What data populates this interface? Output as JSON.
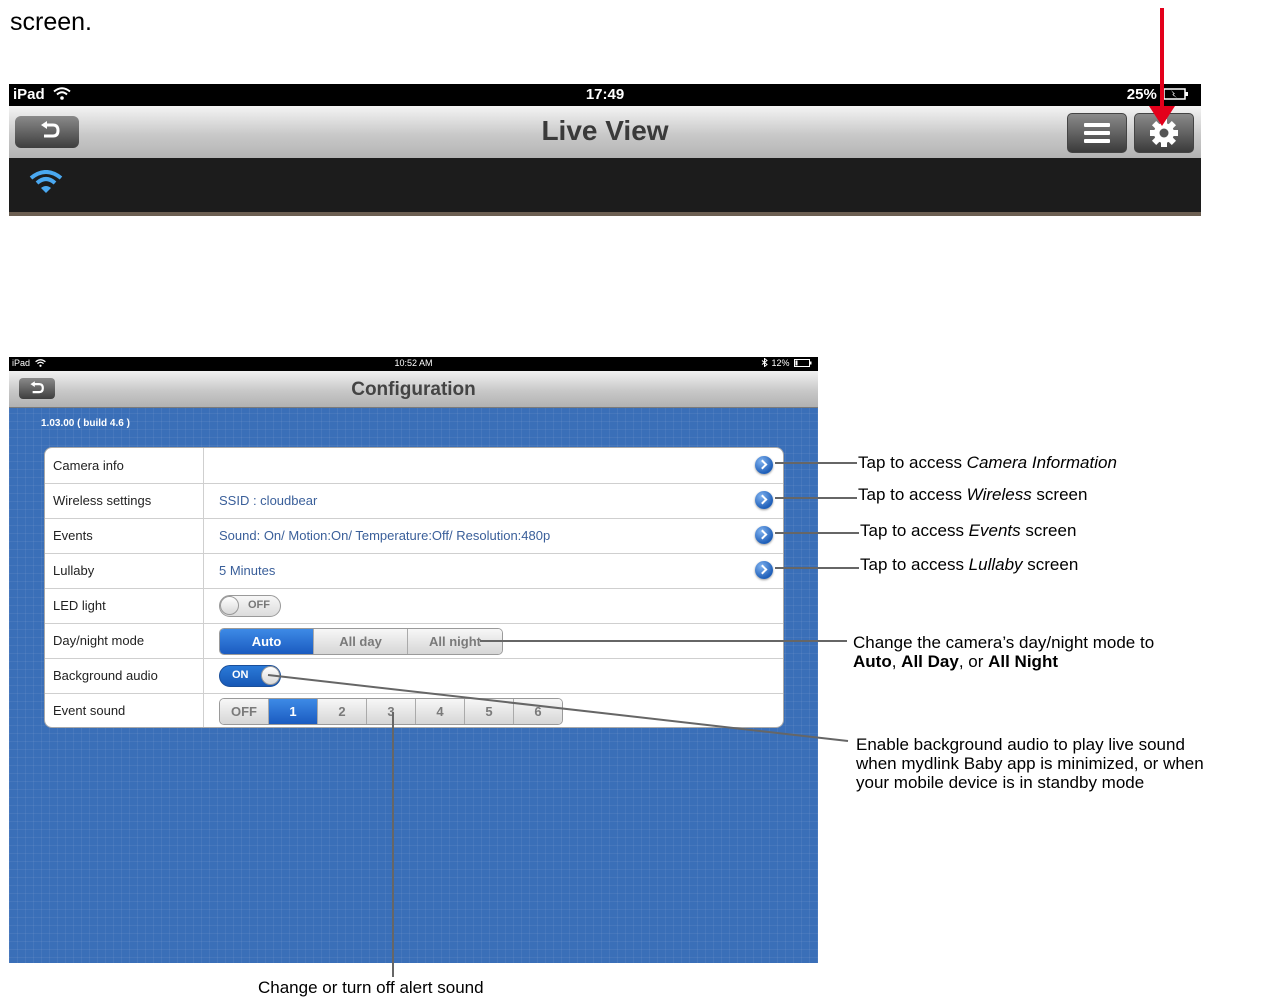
{
  "intro_text": "screen.",
  "liveview": {
    "status_left": "iPad",
    "status_time": "17:49",
    "status_battery": "25%",
    "title": "Live View"
  },
  "config": {
    "status_left": "iPad",
    "status_time": "10:52 AM",
    "status_battery": "12%",
    "title": "Configuration",
    "version": "1.03.00 ( build 4.6 )",
    "rows": [
      {
        "label": "Camera info",
        "value": ""
      },
      {
        "label": "Wireless settings",
        "value": "SSID : cloudbear"
      },
      {
        "label": "Events",
        "value": "Sound: On/ Motion:On/ Temperature:Off/ Resolution:480p"
      },
      {
        "label": "Lullaby",
        "value": "5 Minutes"
      },
      {
        "label": "LED light",
        "toggle": "OFF"
      },
      {
        "label": "Day/night mode",
        "segments": [
          "Auto",
          "All day",
          "All night"
        ],
        "selected": "Auto"
      },
      {
        "label": "Background audio",
        "toggle": "ON"
      },
      {
        "label": "Event sound",
        "segments": [
          "OFF",
          "1",
          "2",
          "3",
          "4",
          "5",
          "6"
        ],
        "selected": "1"
      }
    ]
  },
  "callouts": {
    "camera_info": {
      "prefix": "Tap to access ",
      "em": "Camera Information",
      "suffix": ""
    },
    "wireless": {
      "prefix": "Tap to access ",
      "em": "Wireless",
      "suffix": " screen"
    },
    "events": {
      "prefix": "Tap to access ",
      "em": "Events",
      "suffix": " screen"
    },
    "lullaby": {
      "prefix": "Tap to access ",
      "em": "Lullaby",
      "suffix": " screen"
    },
    "daynight": {
      "line1": "Change the camera’s day/night mode to",
      "b1": "Auto",
      "sep1": ", ",
      "b2": "All Day",
      "sep2": ", or ",
      "b3": "All Night"
    },
    "bg_audio": {
      "line1": "Enable background audio to play live sound",
      "line2": "when mydlink Baby app is minimized, or when",
      "line3": "your mobile device is in standby mode"
    },
    "event_sound": "Change or turn off alert sound"
  },
  "colors": {
    "accent_red": "#e3001b",
    "panel_blue": "#3a6fb8",
    "segment_blue": "#1b5bc0"
  }
}
